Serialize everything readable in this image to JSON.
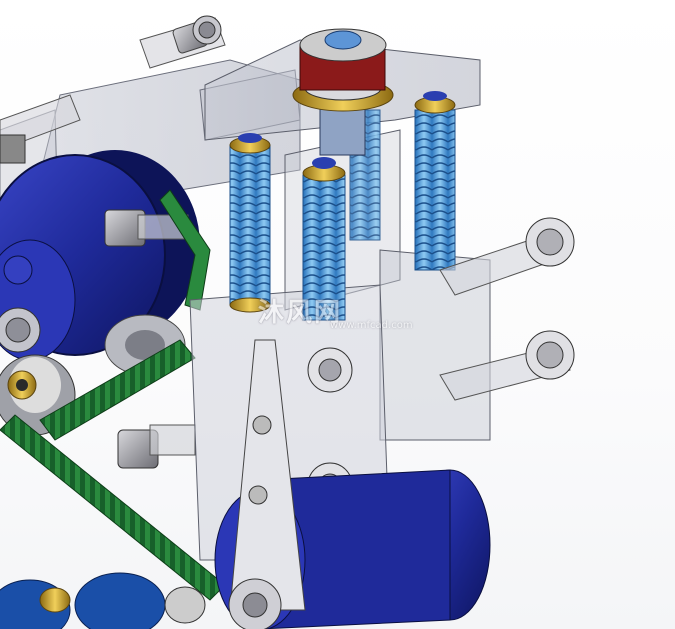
{
  "watermark": {
    "cn_text": "沐风网",
    "url_text": "www.mfcad.com"
  },
  "colors": {
    "motor_blue": "#1f2a9a",
    "spring_blue": "#5aa6e0",
    "brass": "#c9a227",
    "belt_green": "#1f7a34",
    "housing_translucent": "#b9bcc8",
    "plate_white": "#e8e8ec",
    "knob_red": "#8b1a1a"
  },
  "icons": [
    "cnc-watermark-logo"
  ]
}
